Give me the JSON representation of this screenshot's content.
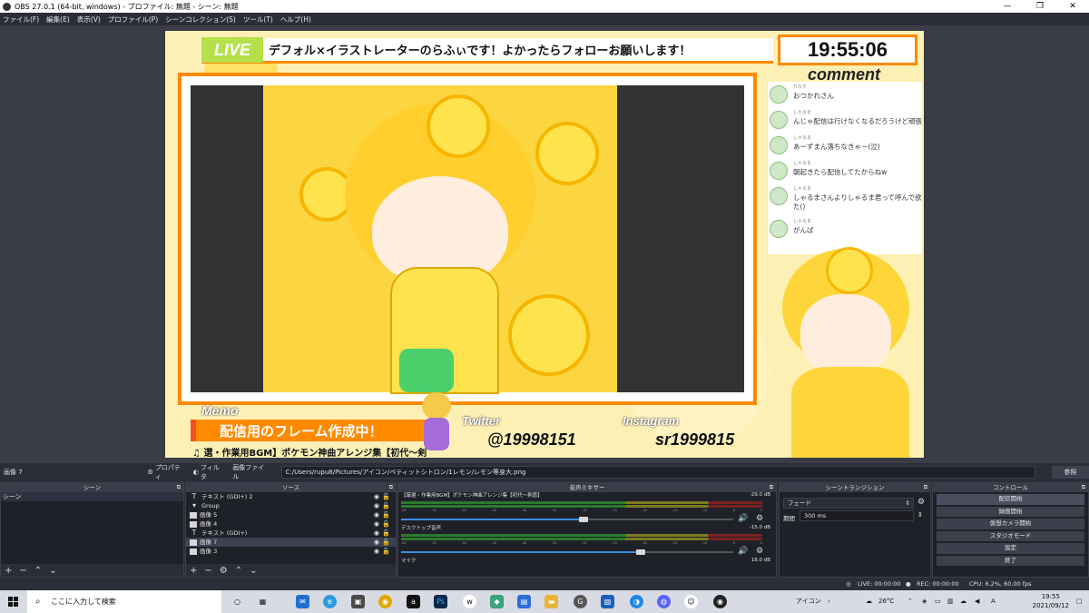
{
  "window": {
    "title": "OBS 27.0.1 (64-bit, windows) - プロファイル: 無題 - シーン: 無題",
    "controls": [
      "—",
      "❐",
      "✕"
    ]
  },
  "menu": [
    "ファイル(F)",
    "編集(E)",
    "表示(V)",
    "プロファイル(P)",
    "シーンコレクション(S)",
    "ツール(T)",
    "ヘルプ(H)"
  ],
  "preview": {
    "live_tag": "LIVE",
    "live_text": "デフォル×イラストレーターのらふぃです！よかったらフォローお願いします！",
    "clock": "19:55:06",
    "comment_title": "comment",
    "comments": [
      {
        "name": "れなす",
        "text": "おつかれさん"
      },
      {
        "name": "しゃるま",
        "text": "んじゃ配信は行けなくなるだろうけど頑張"
      },
      {
        "name": "しゃるま",
        "text": "あーずまん落ちなきゃー(泣)"
      },
      {
        "name": "しゃるま",
        "text": "朝起きたら配信してたからねw"
      },
      {
        "name": "しゃるま",
        "text": "しゃるまさんよりしゃるま君って呼んで欲"
      },
      {
        "name": "",
        "text": "た()"
      },
      {
        "name": "しゃるま",
        "text": "がんば"
      }
    ],
    "memo_title": "Memo",
    "memo_text": "配信用のフレーム作成中！",
    "bgm": "♫ 選・作業用BGM】ポケモン神曲アレンジ集【初代～剣",
    "twitter_label": "Twitter",
    "twitter_value": "@19998151",
    "instagram_label": "Instagram",
    "instagram_value": "sr1999815"
  },
  "source_toolbar": {
    "selected": "画像 7",
    "properties": "プロパティ",
    "filters": "フィルタ",
    "image_file_label": "画像ファイル",
    "path": "C:/Users/rupu8/Pictures/アイコン/ペティットシトロン/1レモン/レモン等身大.png",
    "browse": "参照"
  },
  "scenes_dock": {
    "title": "シーン",
    "items": [
      "シーン"
    ]
  },
  "sources_dock": {
    "title": "ソース",
    "items": [
      {
        "icon": "text",
        "label": "テキスト (GDI+) 2"
      },
      {
        "icon": "group",
        "label": "Group"
      },
      {
        "icon": "image",
        "label": "画像 5"
      },
      {
        "icon": "image",
        "label": "画像 4"
      },
      {
        "icon": "text",
        "label": "テキスト (GDI+)"
      },
      {
        "icon": "image",
        "label": "画像 7"
      },
      {
        "icon": "image",
        "label": "画像 3"
      }
    ]
  },
  "mixer_dock": {
    "title": "音声ミキサー",
    "channels": [
      {
        "name": "【厳選・作業用BGM】ポケモン神曲アレンジ集【初代～剣盾】",
        "db": "-29.0 dB",
        "level": 0.55
      },
      {
        "name": "デスクトップ音声",
        "db": "-15.0 dB",
        "level": 0.72
      },
      {
        "name": "マイク",
        "db": "18.0 dB"
      }
    ],
    "ticks": [
      "-60",
      "-55",
      "-50",
      "-45",
      "-40",
      "-35",
      "-30",
      "-25",
      "-20",
      "-15",
      "-10",
      "-5",
      "0"
    ]
  },
  "transition_dock": {
    "title": "シーントランジション",
    "selected": "フェード",
    "duration_label": "期間",
    "duration_value": "300 ms"
  },
  "controls_dock": {
    "title": "コントロール",
    "buttons": [
      "配信開始",
      "録画開始",
      "仮想カメラ開始",
      "スタジオモード",
      "設定",
      "終了"
    ]
  },
  "status": {
    "live": "LIVE: 00:00:00",
    "rec": "REC: 00:00:00",
    "cpu": "CPU: 6.2%, 60.00 fps"
  },
  "taskbar": {
    "search_placeholder": "ここに入力して検索",
    "tray_label": "アイコン",
    "weather": "26°C",
    "ime": "A",
    "time": "19:55",
    "date": "2021/09/12"
  },
  "colors": {
    "accent_orange": "#ff8a00",
    "live_green": "#b6e04a",
    "lemon_yellow": "#ffd63a",
    "obs_bg": "#2b2e38"
  }
}
